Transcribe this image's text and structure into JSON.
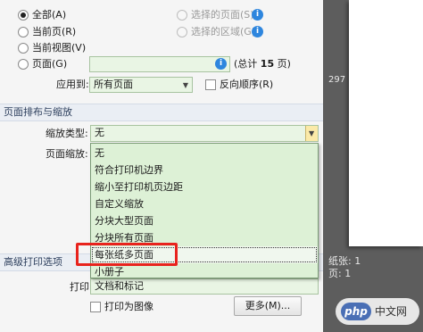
{
  "print_range": {
    "all": "全部(A)",
    "current_page": "当前页(R)",
    "current_view": "当前视图(V)",
    "pages": "页面(G)",
    "selected_pages": "选择的页面(S)",
    "selected_area": "选择的区域(G)",
    "total_prefix": "(总计 ",
    "total_count": "15",
    "total_suffix": " 页)",
    "apply_to_label": "应用到:",
    "apply_to_value": "所有页面",
    "reverse_order": "反向顺序(R)",
    "info_glyph": "i"
  },
  "page_sizing": {
    "section_title": "页面排布与缩放",
    "scale_type_label": "缩放类型:",
    "scale_type_value": "无",
    "page_scale_label": "页面缩放:",
    "options": [
      "无",
      "符合打印机边界",
      "缩小至打印机页边距",
      "自定义缩放",
      "分块大型页面",
      "分块所有页面",
      "每张纸多页面",
      "小册子"
    ],
    "highlighted_option": "每张纸多页面"
  },
  "advanced": {
    "section_title": "高级打印选项",
    "print_label": "打印",
    "print_value": "文档和标记",
    "print_as_image": "打印为图像",
    "more_button": "更多(M)..."
  },
  "preview": {
    "page_number_partial": "297",
    "paper_label": "纸张: 1",
    "pages_label": "页: 1",
    "watermark_logo": "php",
    "watermark_text": "中文网"
  },
  "colors": {
    "accent_red": "#e8231d",
    "field_green": "#e9f5e4",
    "dropdown_green": "#ddf1d6",
    "info_blue": "#2e86de",
    "preview_gray": "#5d5d5d"
  }
}
